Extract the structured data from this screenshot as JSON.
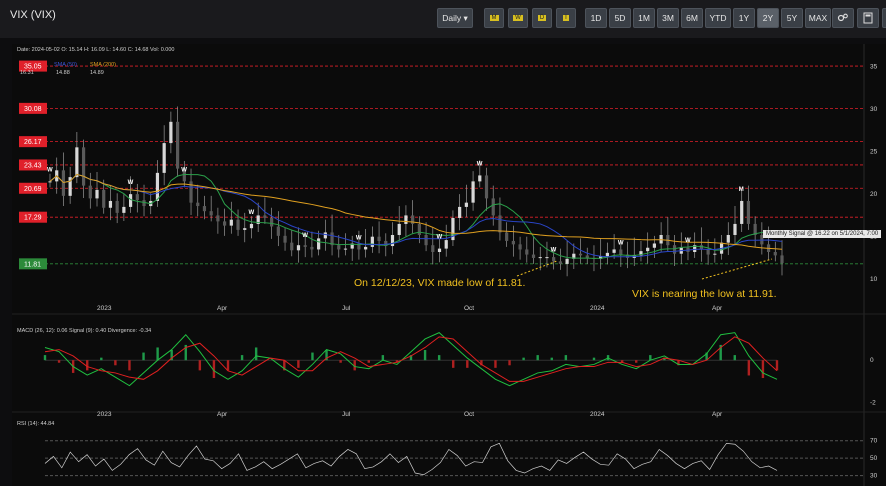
{
  "app": {
    "title": "VIX (VIX)"
  },
  "toolbar": {
    "interval": "Daily ▾",
    "signal_buttons": [
      "M",
      "W",
      "D",
      "I"
    ],
    "ranges": [
      "1D",
      "5D",
      "1M",
      "3M",
      "6M",
      "YTD",
      "1Y",
      "2Y",
      "5Y",
      "MAX"
    ],
    "active_range": "2Y",
    "icons": [
      "settings-icon",
      "calculator-icon",
      "fullscreen-icon"
    ]
  },
  "colors": {
    "bg": "#0d0d0f",
    "level_red": "#e0202a",
    "level_green": "#2c8a3a",
    "sma50": "#2a45c8",
    "sma200": "#e0a020",
    "sma20": "#2aa04a",
    "macd": "#20c040",
    "signal": "#e02020",
    "annotation": "#f0c020"
  },
  "info": {
    "ohlc": "Date: 2024-05-02 O: 15.14 H: 16.09 L: 14.60 C: 14.68 Vol: 0.000",
    "legend_sma50_label": "SMA (50)",
    "legend_sma200_label": "SMA (200)",
    "legend_val1": "16.31",
    "legend_val2": "14.88",
    "legend_val3": "14.89",
    "tooltip": "Monthly Signal @ 16.22 on 5/1/2024, 7:00"
  },
  "annotations": {
    "left": "On 12/12/23, VIX made low of 11.81.",
    "right": "VIX is nearing the low at 11.91."
  },
  "chart_data": [
    {
      "type": "candlestick",
      "title": "VIX (VIX)",
      "x_tick_labels": [
        "2023",
        "Apr",
        "Jul",
        "Oct",
        "2024",
        "Apr"
      ],
      "y_ticks": [
        10,
        15,
        20,
        25,
        30,
        35
      ],
      "ylim": [
        8.5,
        36
      ],
      "levels_red": [
        35.05,
        30.08,
        26.17,
        23.43,
        20.69,
        17.29
      ],
      "levels_green": [
        11.81
      ],
      "series_close": [
        21.5,
        22.8,
        19.8,
        22.0,
        25.5,
        21.0,
        19.5,
        20.5,
        18.4,
        19.2,
        17.8,
        18.5,
        20.0,
        19.3,
        18.6,
        19.2,
        22.5,
        26.0,
        28.5,
        23.0,
        21.5,
        19.0,
        18.6,
        18.0,
        17.5,
        16.8,
        16.3,
        17.0,
        15.8,
        16.0,
        16.5,
        17.5,
        17.2,
        16.2,
        15.1,
        14.3,
        13.4,
        14.0,
        13.8,
        13.5,
        14.8,
        15.5,
        14.0,
        13.5,
        13.6,
        14.2,
        13.5,
        13.8,
        15.0,
        14.5,
        13.9,
        15.2,
        16.5,
        17.5,
        16.5,
        15.2,
        14.0,
        13.2,
        13.6,
        14.6,
        17.2,
        18.5,
        19.0,
        21.5,
        22.2,
        19.5,
        17.5,
        15.5,
        14.5,
        14.1,
        13.5,
        12.9,
        12.5,
        12.6,
        12.6,
        12.1,
        11.8,
        12.4,
        13.0,
        12.8,
        12.5,
        12.4,
        12.7,
        13.1,
        13.5,
        12.9,
        12.5,
        12.8,
        13.3,
        13.7,
        14.2,
        15.2,
        14.0,
        13.0,
        13.7,
        13.2,
        14.0,
        13.5,
        12.9,
        13.0,
        14.3,
        15.2,
        16.5,
        19.2,
        16.5,
        15.2,
        14.1,
        13.2,
        12.8,
        11.9
      ],
      "series_names": [
        "VIX",
        "SMA (50)",
        "SMA (200)"
      ],
      "markers": [
        "W",
        "M"
      ]
    },
    {
      "type": "line",
      "title": "MACD (26, 12): 0.06 Signal (9): 0.40 Divergence: -0.34",
      "y_ticks": [
        0,
        -2
      ],
      "ylim": [
        -2.3,
        1.8
      ],
      "series": [
        {
          "name": "MACD",
          "values": [
            0.6,
            0.4,
            -0.3,
            -0.7,
            -0.4,
            -0.8,
            -1.2,
            -0.6,
            0.0,
            0.5,
            1.2,
            0.4,
            -0.5,
            -0.9,
            -0.5,
            0.2,
            0.1,
            -0.4,
            -0.8,
            -0.2,
            0.5,
            0.3,
            -0.3,
            -0.4,
            0.0,
            -0.2,
            0.4,
            1.0,
            1.3,
            0.7,
            0.1,
            -0.4,
            -0.9,
            -1.2,
            -0.9,
            -0.6,
            -0.5,
            -0.2,
            -0.3,
            -0.2,
            0.1,
            -0.2,
            -0.4,
            0.0,
            0.2,
            -0.2,
            -0.2,
            0.3,
            1.2,
            1.3,
            0.2,
            -0.6,
            -0.9
          ]
        },
        {
          "name": "Signal",
          "values": [
            0.4,
            0.5,
            0.2,
            -0.3,
            -0.5,
            -0.6,
            -0.8,
            -0.9,
            -0.5,
            0.1,
            0.6,
            0.8,
            0.2,
            -0.5,
            -0.7,
            -0.3,
            0.1,
            0.0,
            -0.5,
            -0.5,
            0.1,
            0.4,
            0.1,
            -0.3,
            -0.2,
            -0.1,
            0.2,
            0.6,
            1.1,
            1.0,
            0.4,
            -0.2,
            -0.6,
            -1.0,
            -1.0,
            -0.8,
            -0.6,
            -0.4,
            -0.3,
            -0.3,
            -0.1,
            -0.1,
            -0.3,
            -0.2,
            0.1,
            0.0,
            -0.2,
            0.0,
            0.6,
            1.1,
            0.8,
            0.1,
            -0.5
          ]
        }
      ]
    },
    {
      "type": "line",
      "title": "RSI (14): 44.84",
      "y_ticks": [
        70,
        50,
        30
      ],
      "ylim": [
        25,
        80
      ],
      "series": [
        {
          "name": "RSI",
          "values": [
            44,
            52,
            39,
            57,
            46,
            54,
            41,
            49,
            36,
            43,
            54,
            61,
            48,
            42,
            58,
            45,
            40,
            53,
            64,
            49,
            47,
            38,
            44,
            55,
            36,
            40,
            46,
            38,
            43,
            49,
            55,
            39,
            44,
            47,
            41,
            52,
            60,
            55,
            38,
            40,
            46,
            55,
            45,
            52,
            33,
            31,
            37,
            45,
            60,
            53,
            41,
            46,
            45,
            63,
            67,
            47,
            36,
            33,
            38,
            41,
            36,
            48,
            44,
            51,
            57,
            49,
            43,
            42,
            55,
            49,
            38,
            43,
            46,
            60,
            53,
            44,
            38,
            44,
            47,
            37,
            54,
            67,
            66,
            58,
            46,
            39,
            41,
            36
          ]
        }
      ]
    }
  ]
}
